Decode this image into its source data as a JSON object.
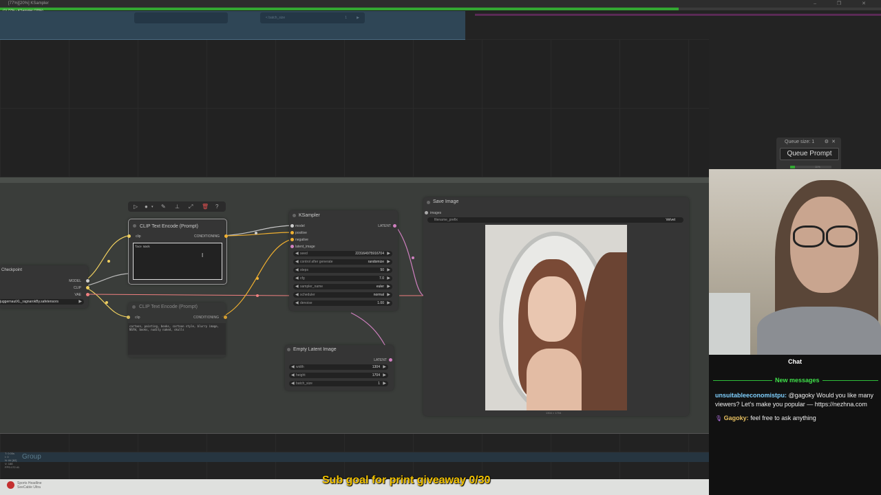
{
  "titlebar": {
    "title": "[77%][20%] KSampler",
    "subtitle": "(1) 77% - KSampler (20%)",
    "window_controls": "– ❐ ✕"
  },
  "progress": {
    "main_fraction": 0.77
  },
  "top_group": {
    "batch_label": "< batch_size",
    "batch_value": "1"
  },
  "group": {
    "label": "Group"
  },
  "nodes": {
    "toolbar": {
      "icons": [
        "play-icon",
        "record-icon",
        "dropdown-icon",
        "pin-tool-icon",
        "bookmark-icon",
        "expand-icon",
        "delete-icon",
        "help-icon"
      ]
    },
    "clip1": {
      "title": "CLIP Text Encode (Prompt)",
      "in_clip": "clip",
      "out": "CONDITIONING",
      "text": "face mask"
    },
    "clip2": {
      "title": "CLIP Text Encode (Prompt)",
      "in_clip": "clip",
      "out": "CONDITIONING",
      "text": "cartoon, painting, books, cartoon style, blurry image, NSFW, books, nudity naked, skulls"
    },
    "checkpoint": {
      "title": "Checkpoint",
      "out_model": "MODEL",
      "out_clip": "CLIP",
      "out_vae": "VAE",
      "ckpt_value": "juggernautXL_ragnarokBy.safetensors"
    },
    "ksampler": {
      "title": "KSampler",
      "inputs": [
        "model",
        "positive",
        "negative",
        "latent_image"
      ],
      "output": "LATENT",
      "widgets": [
        {
          "name": "seed",
          "value": "223164975916704"
        },
        {
          "name": "control after generate",
          "value": "randomize"
        },
        {
          "name": "steps",
          "value": "50"
        },
        {
          "name": "cfg",
          "value": "7.0"
        },
        {
          "name": "sampler_name",
          "value": "euler"
        },
        {
          "name": "scheduler",
          "value": "normal"
        },
        {
          "name": "denoise",
          "value": "1.00"
        }
      ]
    },
    "empty_latent": {
      "title": "Empty Latent Image",
      "output": "LATENT",
      "widgets": [
        {
          "name": "width",
          "value": "1304"
        },
        {
          "name": "height",
          "value": "1704"
        },
        {
          "name": "batch_size",
          "value": "1"
        }
      ]
    },
    "save_image": {
      "title": "Save Image",
      "input": "images",
      "prefix_name": "filename_prefix",
      "prefix_value": "Velvet",
      "caption": "1304 × 1704"
    }
  },
  "queue": {
    "size_label": "Queue size: 1",
    "button": "Queue Prompt",
    "percent": "11%"
  },
  "chat": {
    "title": "Chat",
    "new_messages": "New messages",
    "messages": [
      {
        "user": "unsuitableeconomistpu:",
        "text": " @gagoky Would you like many viewers? Let's make you popular — https://nezhna.com"
      },
      {
        "user": "Gagoky:",
        "text": " feel free to ask anything"
      }
    ]
  },
  "overlay": {
    "sub_goal": "Sub goal for print giveaway 0/30"
  },
  "stats": [
    "T: 0.00s",
    "I: 0",
    "N: 84 [82]",
    "V: 188",
    "FPS:172.41"
  ],
  "news": {
    "line1": "Sports Headline",
    "line2": "SeeCable Ultra"
  },
  "colors": {
    "accent_green": "#33a832",
    "chat_green": "#3fe04a",
    "subgoal_yellow": "#f2c200"
  }
}
